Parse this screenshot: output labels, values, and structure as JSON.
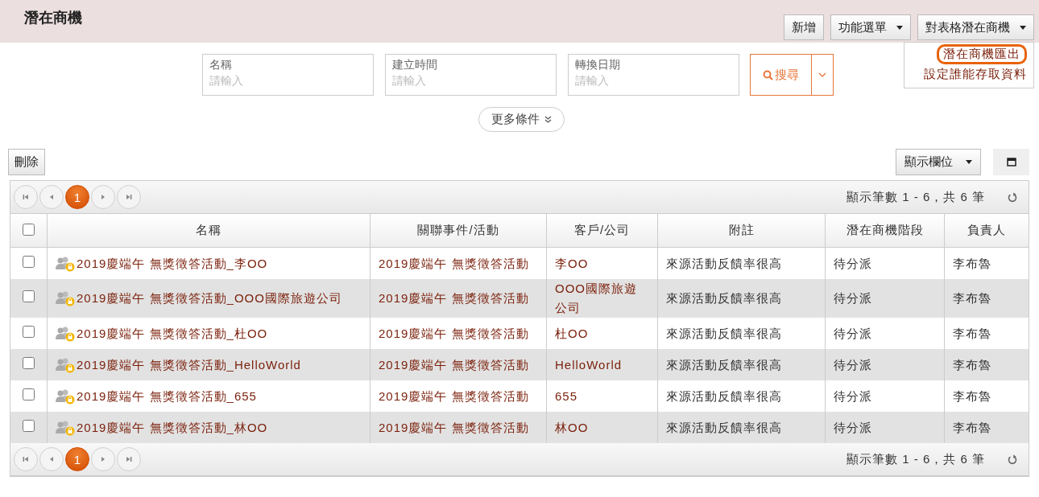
{
  "header": {
    "title": "潛在商機",
    "buttons": [
      {
        "label": "新增",
        "kind": "plain"
      },
      {
        "label": "功能選單",
        "kind": "dropdown"
      },
      {
        "label": "對表格潛在商機",
        "kind": "dropdown",
        "expanded": true
      }
    ]
  },
  "menu": {
    "items": [
      {
        "label": "潛在商機匯出",
        "selected": true
      },
      {
        "label": "設定誰能存取資料",
        "selected": false
      }
    ]
  },
  "search": {
    "fields": [
      {
        "label": "名稱",
        "placeholder": "請輸入"
      },
      {
        "label": "建立時間",
        "placeholder": "請輸入"
      },
      {
        "label": "轉換日期",
        "placeholder": "請輸入"
      }
    ],
    "button": "搜尋",
    "more": "更多條件"
  },
  "toolbar": {
    "delete": "刪除",
    "columns_button": "顯示欄位"
  },
  "pager_top": {
    "pages": [
      {
        "label": "1",
        "selected": true
      }
    ],
    "summary": "顯示筆數 1 - 6，共 6 筆"
  },
  "table": {
    "header_checked": false,
    "columns": [
      "名稱",
      "關聯事件/活動",
      "客戶/公司",
      "附註",
      "潛在商機階段",
      "負責人"
    ],
    "rows": [
      {
        "checked": false,
        "cells": [
          "2019慶端午 無獎徵答活動_李OO",
          "2019慶端午 無獎徵答活動",
          "李OO",
          "來源活動反饋率很高",
          "待分派",
          "李布魯"
        ]
      },
      {
        "checked": false,
        "cells": [
          "2019慶端午 無獎徵答活動_OOO國際旅遊公司",
          "2019慶端午 無獎徵答活動",
          "OOO國際旅遊公司",
          "來源活動反饋率很高",
          "待分派",
          "李布魯"
        ]
      },
      {
        "checked": false,
        "cells": [
          "2019慶端午 無獎徵答活動_杜OO",
          "2019慶端午 無獎徵答活動",
          "杜OO",
          "來源活動反饋率很高",
          "待分派",
          "李布魯"
        ]
      },
      {
        "checked": false,
        "cells": [
          "2019慶端午 無獎徵答活動_HelloWorld",
          "2019慶端午 無獎徵答活動",
          "HelloWorld",
          "來源活動反饋率很高",
          "待分派",
          "李布魯"
        ]
      },
      {
        "checked": false,
        "cells": [
          "2019慶端午 無獎徵答活動_655",
          "2019慶端午 無獎徵答活動",
          "655",
          "來源活動反饋率很高",
          "待分派",
          "李布魯"
        ]
      },
      {
        "checked": false,
        "cells": [
          "2019慶端午 無獎徵答活動_林OO",
          "2019慶端午 無獎徵答活動",
          "林OO",
          "來源活動反饋率很高",
          "待分派",
          "李布魯"
        ]
      }
    ]
  },
  "pager_bottom": {
    "pages": [
      {
        "label": "1",
        "selected": true
      }
    ],
    "summary": "顯示筆數 1 - 6，共 6 筆"
  }
}
